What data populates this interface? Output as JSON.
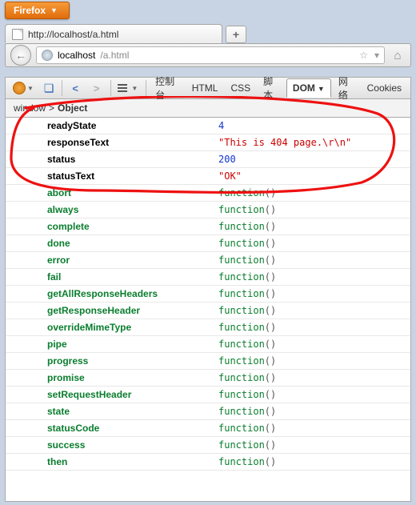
{
  "firefox_button": "Firefox",
  "tab": {
    "title": "http://localhost/a.html"
  },
  "url": {
    "host": "localhost",
    "path": "/a.html"
  },
  "firebug_tabs": {
    "console": "控制台",
    "html": "HTML",
    "css": "CSS",
    "script": "脚本",
    "dom": "DOM",
    "net": "网络",
    "cookies": "Cookies"
  },
  "breadcrumb": {
    "root": "window",
    "sep": ">",
    "current": "Object"
  },
  "props": [
    {
      "key": "readyState",
      "type": "data",
      "vtype": "num",
      "val": "4"
    },
    {
      "key": "responseText",
      "type": "data",
      "vtype": "str",
      "val": "\"This is 404 page.\\r\\n\""
    },
    {
      "key": "status",
      "type": "data",
      "vtype": "num",
      "val": "200"
    },
    {
      "key": "statusText",
      "type": "data",
      "vtype": "str",
      "val": "\"OK\""
    },
    {
      "key": "abort",
      "type": "method",
      "vtype": "fn",
      "val": "function"
    },
    {
      "key": "always",
      "type": "method",
      "vtype": "fn",
      "val": "function"
    },
    {
      "key": "complete",
      "type": "method",
      "vtype": "fn",
      "val": "function"
    },
    {
      "key": "done",
      "type": "method",
      "vtype": "fn",
      "val": "function"
    },
    {
      "key": "error",
      "type": "method",
      "vtype": "fn",
      "val": "function"
    },
    {
      "key": "fail",
      "type": "method",
      "vtype": "fn",
      "val": "function"
    },
    {
      "key": "getAllResponseHeaders",
      "type": "method",
      "vtype": "fn",
      "val": "function"
    },
    {
      "key": "getResponseHeader",
      "type": "method",
      "vtype": "fn",
      "val": "function"
    },
    {
      "key": "overrideMimeType",
      "type": "method",
      "vtype": "fn",
      "val": "function"
    },
    {
      "key": "pipe",
      "type": "method",
      "vtype": "fn",
      "val": "function"
    },
    {
      "key": "progress",
      "type": "method",
      "vtype": "fn",
      "val": "function"
    },
    {
      "key": "promise",
      "type": "method",
      "vtype": "fn",
      "val": "function"
    },
    {
      "key": "setRequestHeader",
      "type": "method",
      "vtype": "fn",
      "val": "function"
    },
    {
      "key": "state",
      "type": "method",
      "vtype": "fn",
      "val": "function"
    },
    {
      "key": "statusCode",
      "type": "method",
      "vtype": "fn",
      "val": "function"
    },
    {
      "key": "success",
      "type": "method",
      "vtype": "fn",
      "val": "function"
    },
    {
      "key": "then",
      "type": "method",
      "vtype": "fn",
      "val": "function"
    }
  ]
}
